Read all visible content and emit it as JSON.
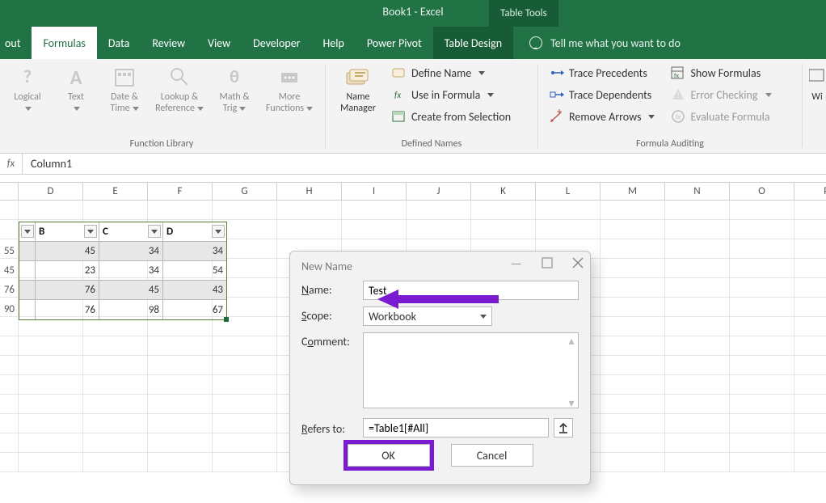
{
  "window": {
    "title": "Book1  -  Excel",
    "context_tools": "Table Tools"
  },
  "tabs": {
    "about": "out",
    "formulas": "Formulas",
    "data": "Data",
    "review": "Review",
    "view": "View",
    "developer": "Developer",
    "help": "Help",
    "power_pivot": "Power Pivot",
    "table_design": "Table Design",
    "tell_me": "Tell me what you want to do"
  },
  "ribbon": {
    "function_library": {
      "label": "Function Library",
      "logical": "Logical",
      "text": "Text",
      "date_time": "Date & Time",
      "lookup_ref": "Lookup & Reference",
      "math_trig": "Math & Trig",
      "more_fn": "More Functions"
    },
    "defined_names": {
      "label": "Defined Names",
      "name_manager": "Name Manager",
      "define_name": "Define Name",
      "use_in_formula": "Use in Formula",
      "create_from_selection": "Create from Selection"
    },
    "formula_auditing": {
      "label": "Formula Auditing",
      "trace_precedents": "Trace Precedents",
      "trace_dependents": "Trace Dependents",
      "remove_arrows": "Remove Arrows",
      "show_formulas": "Show Formulas",
      "error_checking": "Error Checking",
      "evaluate_formula": "Evaluate Formula"
    },
    "w_group": "Wi"
  },
  "formula_bar": {
    "fx": "fx",
    "value": "Column1"
  },
  "columns": [
    "D",
    "E",
    "F",
    "G",
    "H",
    "I",
    "J",
    "K",
    "L",
    "M",
    "N",
    "O",
    "P"
  ],
  "table": {
    "headers": [
      "B",
      "C",
      "D"
    ],
    "left_col": [
      "55",
      "45",
      "76",
      "90"
    ],
    "rows": [
      {
        "b": 45,
        "c": 34,
        "d": 34
      },
      {
        "b": 23,
        "c": 34,
        "d": 54
      },
      {
        "b": 76,
        "c": 45,
        "d": 43
      },
      {
        "b": 76,
        "c": 98,
        "d": 67
      }
    ]
  },
  "dialog": {
    "title": "New Name",
    "name_label": "Name:",
    "name_value": "Test",
    "scope_label": "Scope:",
    "scope_value": "Workbook",
    "comment_label": "Comment:",
    "refers_label": "Refers to:",
    "refers_value": "=Table1[#All]",
    "ok": "OK",
    "cancel": "Cancel"
  }
}
